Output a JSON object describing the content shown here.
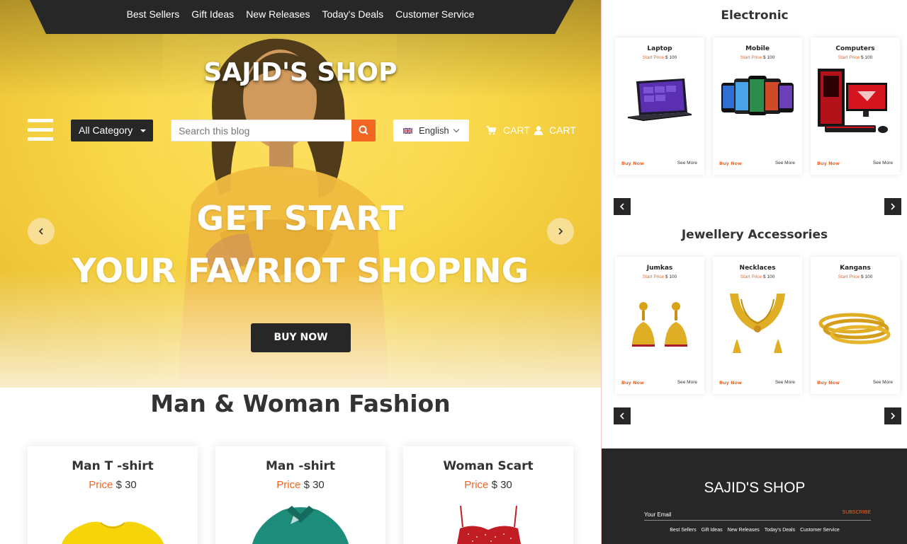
{
  "colors": {
    "accent": "#f26522",
    "dark": "#272727",
    "hero_yellow": "#f8d748"
  },
  "nav": {
    "links": [
      "Best Sellers",
      "Gift Ideas",
      "New Releases",
      "Today's Deals",
      "Customer Service"
    ]
  },
  "header": {
    "brand": "SAJID'S SHOP",
    "category_label": "All Category",
    "search_placeholder": "Search this blog",
    "language": "English",
    "cart_label": "CART",
    "account_label": "CART"
  },
  "hero": {
    "title_line1": "GET START",
    "title_line2": "YOUR FAVRIOT SHOPING",
    "button": "BUY NOW"
  },
  "fashion": {
    "title": "Man & Woman Fashion",
    "products": [
      {
        "name": "Man T -shirt",
        "price_label": "Price",
        "price": "$ 30"
      },
      {
        "name": "Man -shirt",
        "price_label": "Price",
        "price": "$ 30"
      },
      {
        "name": "Woman Scart",
        "price_label": "Price",
        "price": "$ 30"
      }
    ]
  },
  "electronic": {
    "title": "Electronic",
    "products": [
      {
        "name": "Laptop",
        "price_label": "Start Price",
        "price": "$ 100",
        "buy": "Buy Now",
        "more": "See More"
      },
      {
        "name": "Mobile",
        "price_label": "Start Price",
        "price": "$ 100",
        "buy": "Buy Now",
        "more": "See More"
      },
      {
        "name": "Computers",
        "price_label": "Start Price",
        "price": "$ 100",
        "buy": "Buy Now",
        "more": "See More"
      }
    ]
  },
  "jewellery": {
    "title": "Jewellery Accessories",
    "products": [
      {
        "name": "Jumkas",
        "price_label": "Start Price",
        "price": "$ 100",
        "buy": "Buy Now",
        "more": "See More"
      },
      {
        "name": "Necklaces",
        "price_label": "Start Price",
        "price": "$ 100",
        "buy": "Buy Now",
        "more": "See More"
      },
      {
        "name": "Kangans",
        "price_label": "Start Price",
        "price": "$ 100",
        "buy": "Buy Now",
        "more": "See More"
      }
    ]
  },
  "footer": {
    "brand": "SAJID'S SHOP",
    "email_placeholder": "Your Email",
    "subscribe": "SUBSCRIBE",
    "links": [
      "Best Sellers",
      "Gift Ideas",
      "New Releases",
      "Today's Deals",
      "Customer Service"
    ]
  }
}
